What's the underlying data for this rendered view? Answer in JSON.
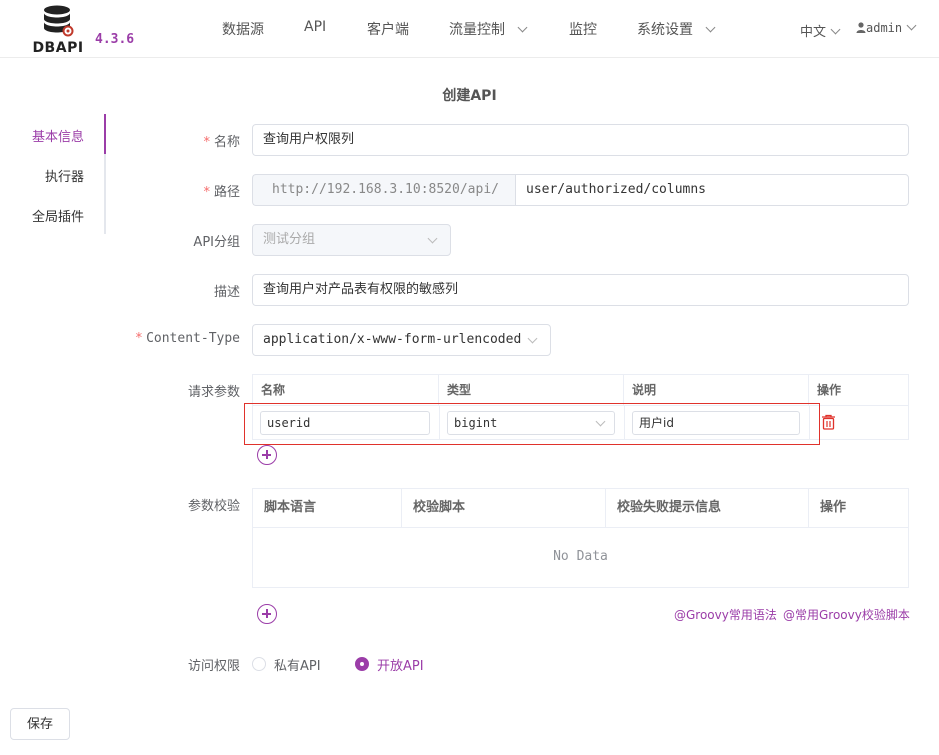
{
  "header": {
    "logo_text": "DBAPI",
    "version": "4.3.6",
    "nav": [
      "数据源",
      "API",
      "客户端",
      "流量控制",
      "监控",
      "系统设置"
    ],
    "language": "中文",
    "user": "admin"
  },
  "page": {
    "title": "创建API"
  },
  "side_menu": [
    "基本信息",
    "执行器",
    "全局插件"
  ],
  "form": {
    "name_label": "名称",
    "name_value": "查询用户权限列",
    "path_label": "路径",
    "path_prefix": "http://192.168.3.10:8520/api/",
    "path_value": "user/authorized/columns",
    "group_label": "API分组",
    "group_value": "测试分组",
    "desc_label": "描述",
    "desc_value": "查询用户对产品表有权限的敏感列",
    "content_type_label": "Content-Type",
    "content_type_value": "application/x-www-form-urlencoded",
    "params_label": "请求参数",
    "params_columns": [
      "名称",
      "类型",
      "说明",
      "操作"
    ],
    "params_row": {
      "name": "userid",
      "type": "bigint",
      "desc": "用户id"
    },
    "validate_label": "参数校验",
    "validate_columns": [
      "脚本语言",
      "校验脚本",
      "校验失败提示信息",
      "操作"
    ],
    "validate_empty": "No Data",
    "link_groovy_syntax": "@Groovy常用语法",
    "link_groovy_scripts": "@常用Groovy校验脚本",
    "access_label": "访问权限",
    "access_private": "私有API",
    "access_public": "开放API",
    "save_label": "保存"
  },
  "colors": {
    "accent": "#9b3da8",
    "required": "#f56c6c",
    "highlight_box": "#e0322b"
  }
}
